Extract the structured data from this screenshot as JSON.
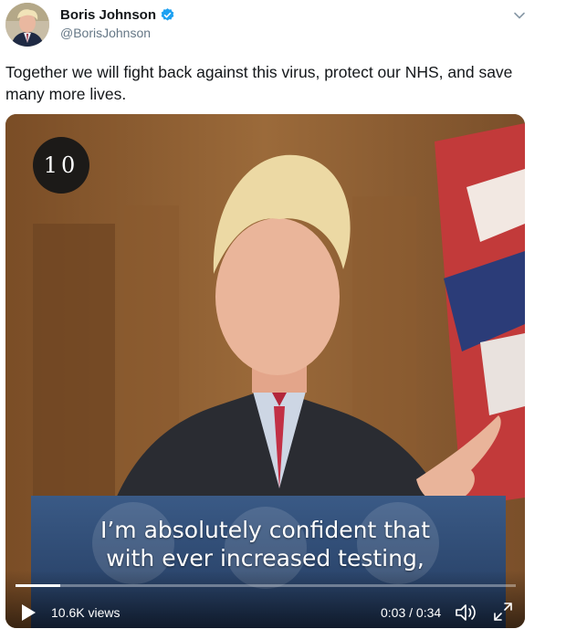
{
  "tweet": {
    "author_name": "Boris Johnson",
    "handle": "@BorisJohnson",
    "text": "Together we will fight back against this virus, protect our NHS, and save many more lives."
  },
  "video": {
    "badge": "10",
    "subtitle_line1": "I’m absolutely confident that",
    "subtitle_line2": "with ever increased testing,",
    "views": "10.6K views",
    "time": "0:03 / 0:34",
    "progress": 0.09
  },
  "icons": {
    "verified": "verified-badge-icon",
    "menu": "chevron-down-icon",
    "play": "play-icon",
    "volume": "volume-icon",
    "fullscreen": "fullscreen-icon"
  },
  "colors": {
    "verified": "#1da1f2",
    "text": "#14171a",
    "secondary": "#657786"
  }
}
